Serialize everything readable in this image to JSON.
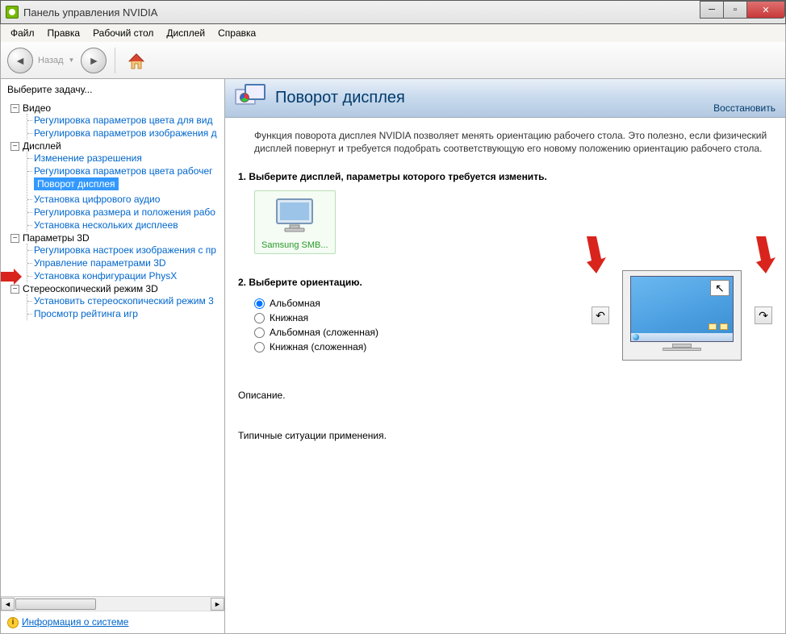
{
  "window": {
    "title": "Панель управления NVIDIA"
  },
  "menu": {
    "file": "Файл",
    "edit": "Правка",
    "desktop": "Рабочий стол",
    "display": "Дисплей",
    "help": "Справка"
  },
  "toolbar": {
    "back": "Назад"
  },
  "sidebar": {
    "title": "Выберите задачу...",
    "categories": [
      {
        "label": "Видео",
        "items": [
          "Регулировка параметров цвета для вид",
          "Регулировка параметров изображения д"
        ]
      },
      {
        "label": "Дисплей",
        "items": [
          "Изменение разрешения",
          "Регулировка параметров цвета рабочег",
          "Поворот дисплея",
          "Установка цифрового аудио",
          "Регулировка размера и положения рабо",
          "Установка нескольких дисплеев"
        ]
      },
      {
        "label": "Параметры 3D",
        "items": [
          "Регулировка настроек изображения с пр",
          "Управление параметрами 3D",
          "Установка конфигурации PhysX"
        ]
      },
      {
        "label": "Стереоскопический режим 3D",
        "items": [
          "Установить стереоскопический режим 3",
          "Просмотр рейтинга игр"
        ]
      }
    ],
    "selected": "Поворот дисплея",
    "sysinfo": "Информация о системе"
  },
  "content": {
    "title": "Поворот дисплея",
    "restore": "Восстановить",
    "intro": "Функция поворота дисплея NVIDIA позволяет менять ориентацию рабочего стола. Это полезно, если физический дисплей повернут и требуется подобрать соответствующую его новому положению ориентацию рабочего стола.",
    "step1": "1. Выберите дисплей, параметры которого требуется изменить.",
    "monitor_label": "Samsung SMB...",
    "step2": "2. Выберите ориентацию.",
    "options": [
      "Альбомная",
      "Книжная",
      "Альбомная (сложенная)",
      "Книжная (сложенная)"
    ],
    "selected_option": "Альбомная",
    "description": "Описание.",
    "typical": "Типичные ситуации применения."
  }
}
